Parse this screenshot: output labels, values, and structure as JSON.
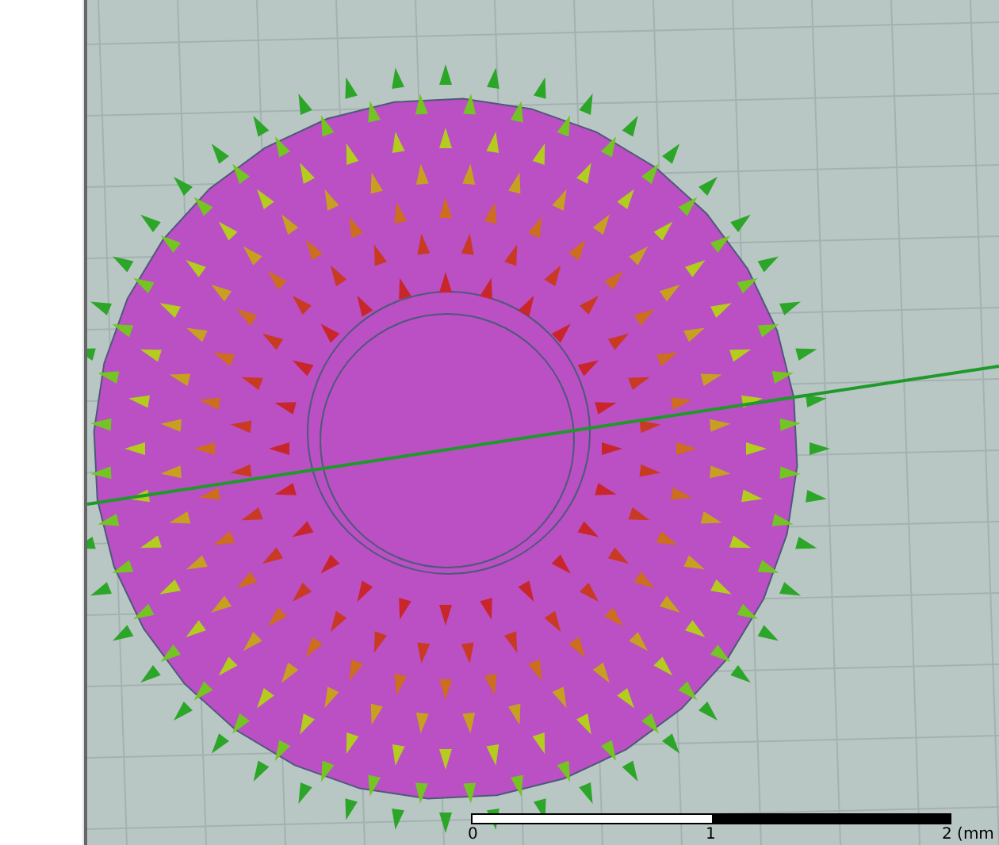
{
  "viewport": {
    "scale_bar": {
      "labels": [
        "0",
        "1",
        "2 (mm"
      ]
    }
  }
}
